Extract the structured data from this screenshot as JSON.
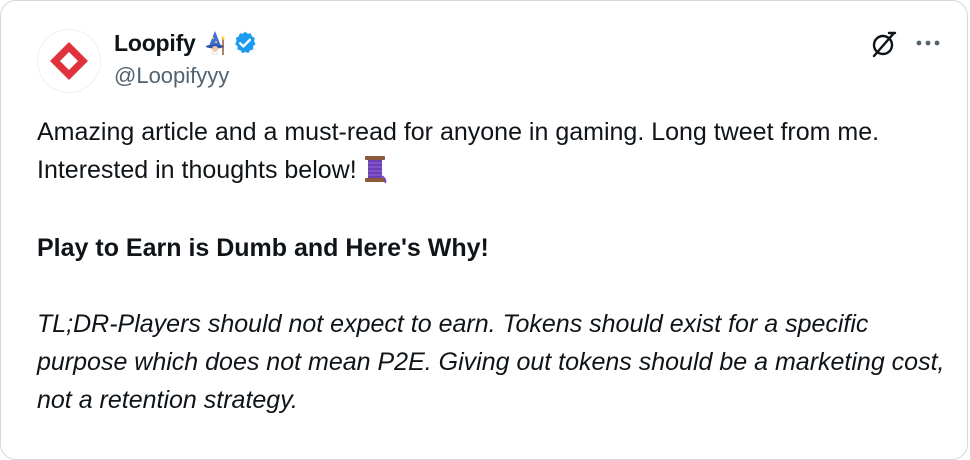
{
  "author": {
    "display_name": "Loopify",
    "handle": "@Loopifyyy",
    "emoji": "wizard-icon",
    "verified": true,
    "avatar_color": "#e0323c"
  },
  "actions": {
    "grok_icon": "grok-icon",
    "more_icon": "more-icon"
  },
  "tweet": {
    "line1": "Amazing article and a must-read for anyone in gaming. Long tweet from me. Interested in thoughts below!",
    "thread_emoji": "thread-icon",
    "heading": "Play to Earn is Dumb and Here's Why!",
    "tldr": "TL;DR-Players should not expect to earn. Tokens should exist for a specific purpose which does not mean P2E. Giving out tokens should be a marketing cost, not a retention strategy."
  },
  "colors": {
    "text": "#0f1419",
    "secondary": "#536471",
    "verified": "#1d9bf0",
    "border": "#cfd9de"
  }
}
